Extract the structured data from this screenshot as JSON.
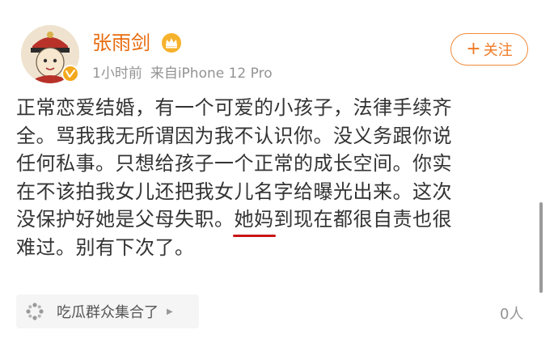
{
  "header": {
    "username": "张雨剑",
    "timestamp": "1小时前",
    "source": "来自iPhone 12 Pro",
    "follow_plus": "+",
    "follow_label": "关注"
  },
  "post": {
    "lines": [
      "正常恋爱结婚，有一个可爱的小孩子，法律手续齐",
      "全。骂我我无所谓因为我不认识你。没义务跟你说",
      "任何私事。只想给孩子一个正常的成长空间。你实",
      "在不该拍我女儿还把我女儿名字给曝光出来。这次"
    ],
    "line5_before": "没保护好她是父母失职。",
    "line5_underlined": "她妈",
    "line5_after": "到现在都很自责也很",
    "line6": "难过。别有下次了。"
  },
  "footer": {
    "topic_label": "吃瓜群众集合了",
    "topic_arrow": "▶",
    "count": "0人"
  },
  "colors": {
    "username": "#e86b0e",
    "follow_border": "#f08a3a",
    "underline": "#c81414",
    "meta_text": "#939393"
  },
  "icons": {
    "avatar": "cartoon-portrait-avatar",
    "verified": "verified-badge-icon",
    "crown": "crown-icon",
    "topic": "dots-cluster-icon"
  }
}
